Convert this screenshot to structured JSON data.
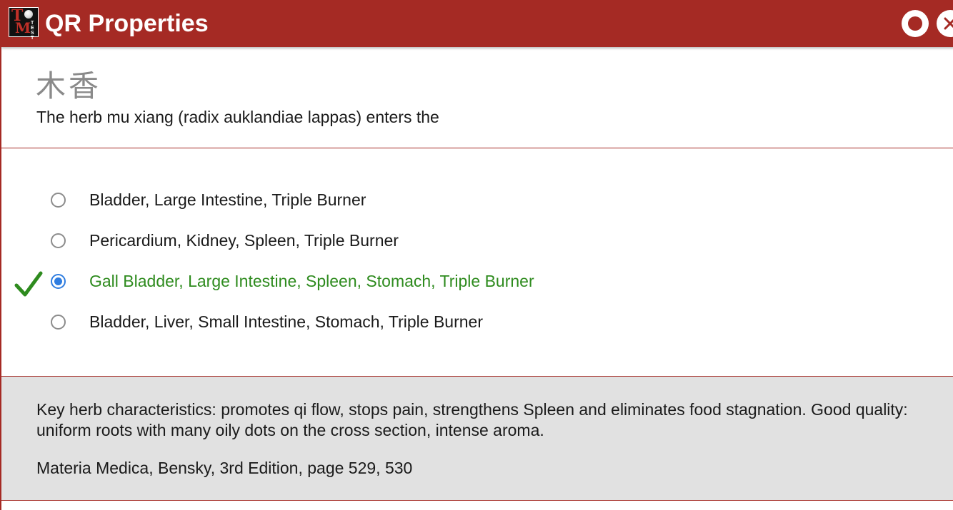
{
  "window": {
    "title": "QR Properties",
    "logo_letters": "TM",
    "logo_small_text": "TEST",
    "record_icon": "record-icon",
    "close_icon": "close-icon"
  },
  "question": {
    "herb_hanzi": "木香",
    "prompt": "The herb mu xiang (radix auklandiae lappas) enters the"
  },
  "options": [
    {
      "label": "Bladder, Large Intestine, Triple Burner",
      "selected": false,
      "correct": false
    },
    {
      "label": "Pericardium, Kidney, Spleen, Triple Burner",
      "selected": false,
      "correct": false
    },
    {
      "label": "Gall Bladder, Large Intestine, Spleen, Stomach, Triple Burner",
      "selected": true,
      "correct": true
    },
    {
      "label": "Bladder, Liver, Small Intestine, Stomach, Triple Burner",
      "selected": false,
      "correct": false
    }
  ],
  "feedback": {
    "correct_icon": "checkmark-icon",
    "explanation": "Key herb characteristics: promotes qi flow, stops pain, strengthens Spleen and eliminates food stagnation. Good quality: uniform roots with many oily dots on the cross section, intense aroma.",
    "source": "Materia Medica, Bensky, 3rd Edition, page 529, 530"
  },
  "colors": {
    "titlebar": "#a52a24",
    "correct_text": "#2e8b1e",
    "radio_selected": "#2f7de0",
    "explanation_bg": "#e1e1e1"
  }
}
